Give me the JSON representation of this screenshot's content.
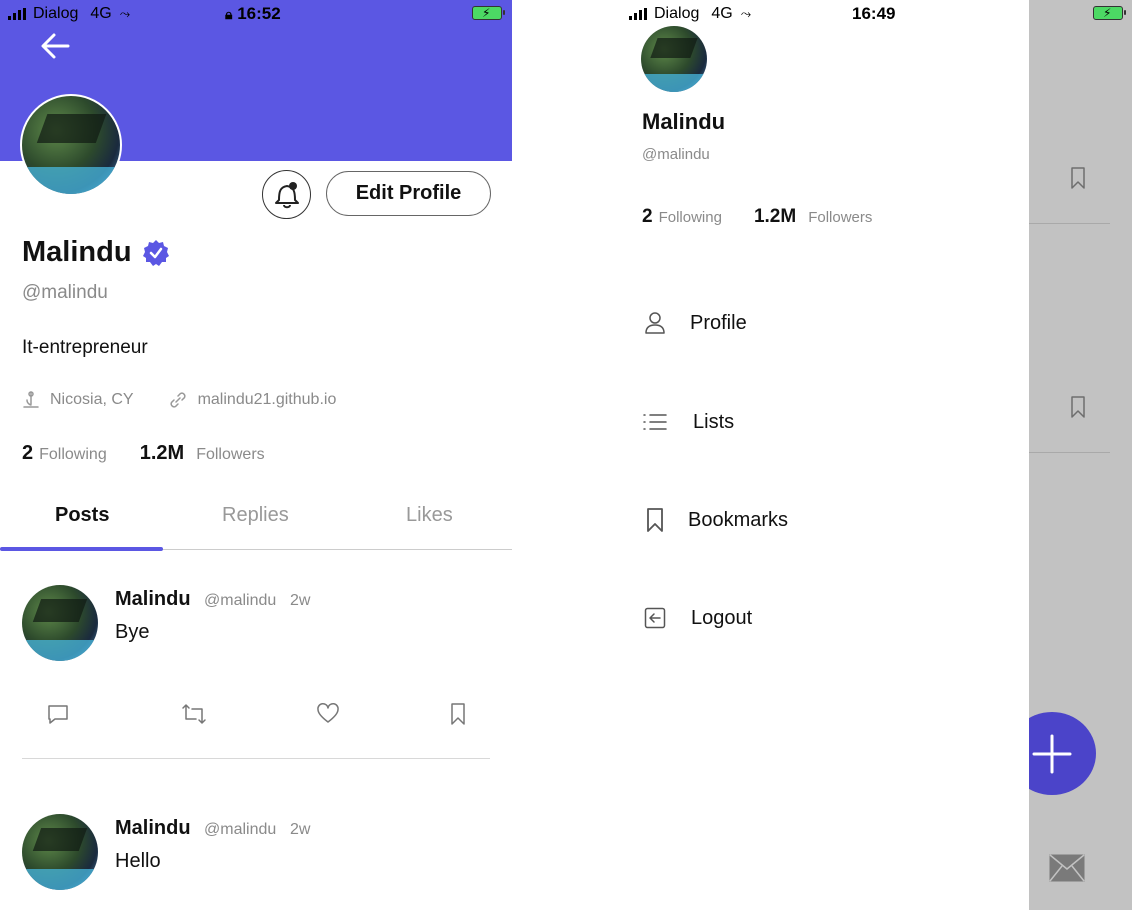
{
  "colors": {
    "accent": "#5b57e3",
    "fab": "#4b44c9",
    "overlay": "#c2c2c2",
    "verified": "#5b57e3"
  },
  "left": {
    "status": {
      "carrier": "Dialog",
      "network": "4G",
      "time": "16:52"
    },
    "profile": {
      "name": "Malindu",
      "handle": "@malindu",
      "bio": "It-entrepreneur",
      "location": "Nicosia, CY",
      "website": "malindu21.github.io",
      "following_count": "2",
      "following_label": "Following",
      "followers_count": "1.2M",
      "followers_label": "Followers",
      "edit_button": "Edit Profile"
    },
    "tabs": [
      {
        "label": "Posts",
        "active": true
      },
      {
        "label": "Replies",
        "active": false
      },
      {
        "label": "Likes",
        "active": false
      }
    ],
    "posts": [
      {
        "name": "Malindu",
        "handle": "@malindu",
        "age": "2w",
        "text": "Bye"
      },
      {
        "name": "Malindu",
        "handle": "@malindu",
        "age": "2w",
        "text": "Hello"
      }
    ]
  },
  "right": {
    "status": {
      "carrier": "Dialog",
      "network": "4G",
      "time": "16:49"
    },
    "drawer": {
      "name": "Malindu",
      "handle": "@malindu",
      "following_count": "2",
      "following_label": "Following",
      "followers_count": "1.2M",
      "followers_label": "Followers",
      "menu": [
        {
          "label": "Profile",
          "icon": "person-icon"
        },
        {
          "label": "Lists",
          "icon": "list-icon"
        },
        {
          "label": "Bookmarks",
          "icon": "bookmark-icon"
        },
        {
          "label": "Logout",
          "icon": "logout-icon"
        }
      ]
    }
  }
}
